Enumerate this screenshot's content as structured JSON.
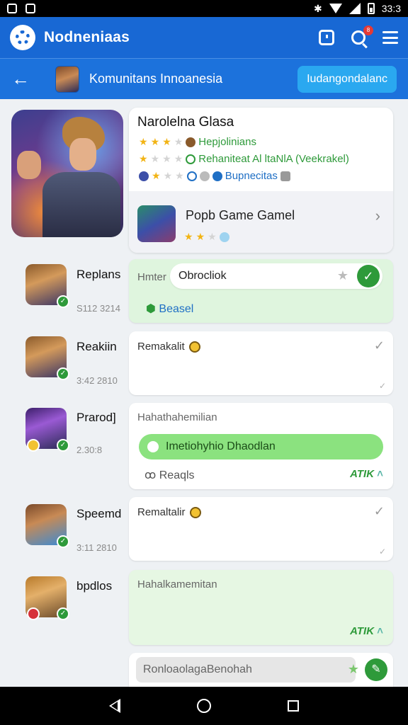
{
  "status_bar": {
    "time": "33:3"
  },
  "app_bar": {
    "title": "Nodneniaas",
    "notification_badge": "8"
  },
  "sub_bar": {
    "community_name": "Komunitans Innoanesia",
    "join_button": "Iudangondalanc"
  },
  "hero": {
    "game_name": "Narolelna Glasa",
    "line1": "Hepjolinians",
    "line2": "Rehaniteat Al ltaNlA (Veekrakel)",
    "line3": "Bupnecitas",
    "game_sub_title": "Popb Game Gamel"
  },
  "feed": [
    {
      "name": "Replans",
      "time": "S112 3214",
      "label": "Hmter",
      "input": "Obrocliok",
      "link": "Beasel"
    },
    {
      "name": "Reakiin",
      "time": "3:42 2810",
      "label": "Remakalit"
    },
    {
      "name": "Prarod]",
      "time": "2.30:8",
      "label": "Hahathahemilian",
      "pill": "Imetiohyhio Dhaodlan",
      "reacts": "Reaqls",
      "count": "ATIK"
    },
    {
      "name": "Speemd",
      "time": "3:11 2810",
      "label": "Remaltalir"
    },
    {
      "name": "bpdlos",
      "label": "Hahalkamemitan",
      "count": "ATIK"
    }
  ],
  "compose": {
    "placeholder": "RonloaolagaBenohah"
  }
}
